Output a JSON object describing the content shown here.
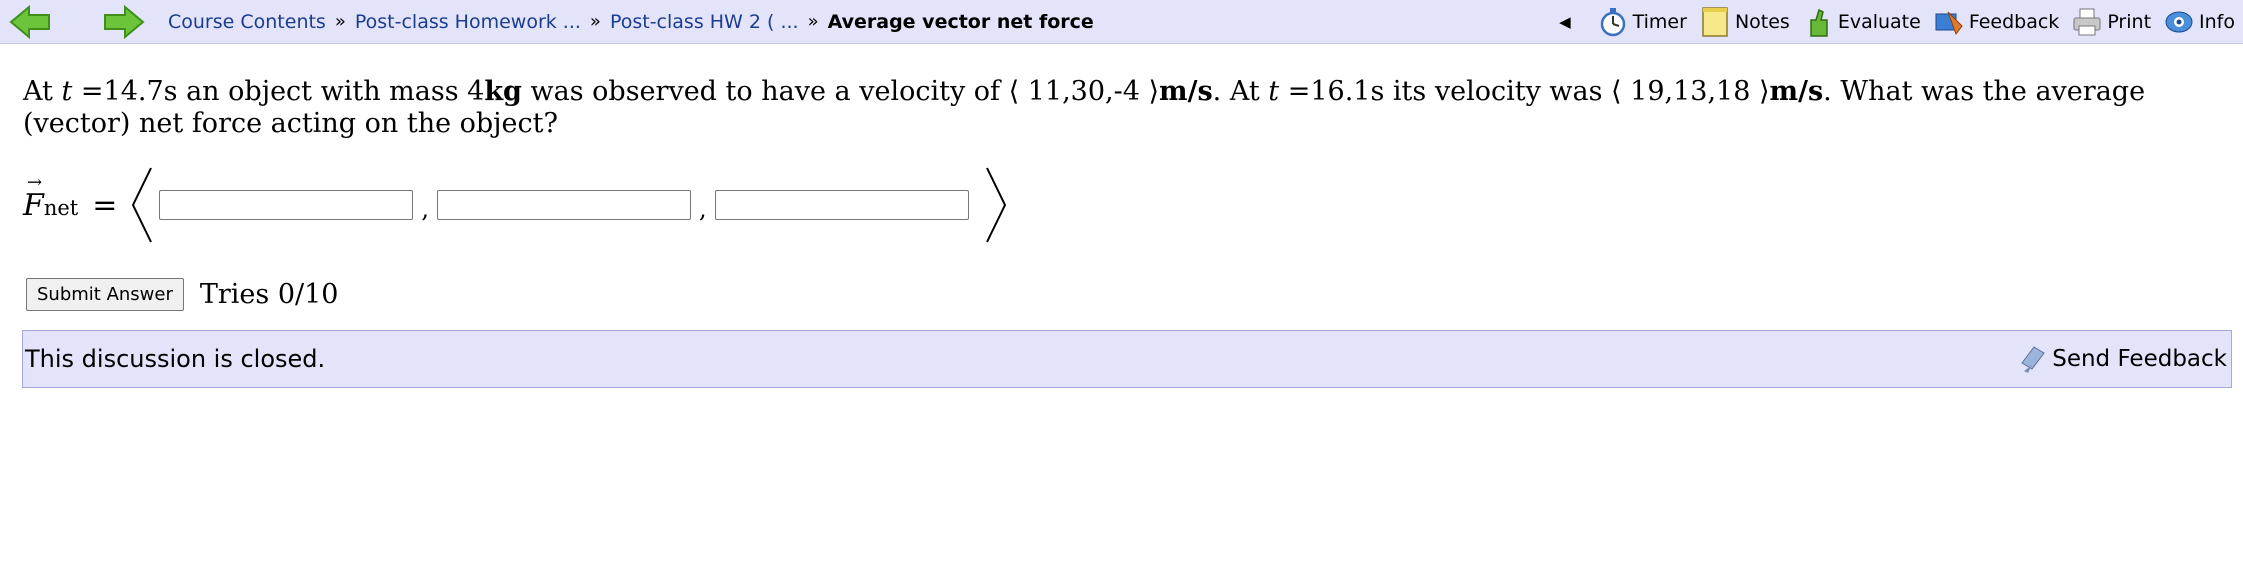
{
  "nav": {
    "breadcrumbs": [
      {
        "label": "Course Contents"
      },
      {
        "label": "Post-class Homework ..."
      },
      {
        "label": "Post-class HW 2 ( ..."
      }
    ],
    "separator": "»",
    "current": "Average vector net force"
  },
  "tools": {
    "collapse": "◀",
    "items": [
      {
        "label": "Timer",
        "icon": "timer-icon"
      },
      {
        "label": "Notes",
        "icon": "notes-icon"
      },
      {
        "label": "Evaluate",
        "icon": "evaluate-icon"
      },
      {
        "label": "Feedback",
        "icon": "feedback-icon"
      },
      {
        "label": "Print",
        "icon": "print-icon"
      },
      {
        "label": "Info",
        "icon": "info-icon"
      }
    ]
  },
  "problem": {
    "p1": "At ",
    "t": "t",
    "p2": " =14.7s an object with mass 4",
    "kg": "kg",
    "p3": " was observed to have a velocity of ⟨ 11,30,-4 ⟩",
    "unit1": "m/s",
    "p4": ". At ",
    "t2": "t",
    "p5": " =16.1s its velocity was ⟨ 19,13,18 ⟩",
    "unit2": "m/s",
    "p6": ". What was the average (vector) net force acting on the object?"
  },
  "answer": {
    "symbol": "F",
    "subscript": "net",
    "equals": "=",
    "comma": ",",
    "inputs": [
      {
        "value": "",
        "placeholder": ""
      },
      {
        "value": "",
        "placeholder": ""
      },
      {
        "value": "",
        "placeholder": ""
      }
    ]
  },
  "submit": {
    "label": "Submit Answer",
    "tries": "Tries 0/10"
  },
  "discussion": {
    "text": "This discussion is closed.",
    "send_feedback": "Send Feedback"
  },
  "colors": {
    "bar_bg": "#e3e3f9",
    "link": "#1a3d8f",
    "arrow_green": "#5cbf2a"
  }
}
